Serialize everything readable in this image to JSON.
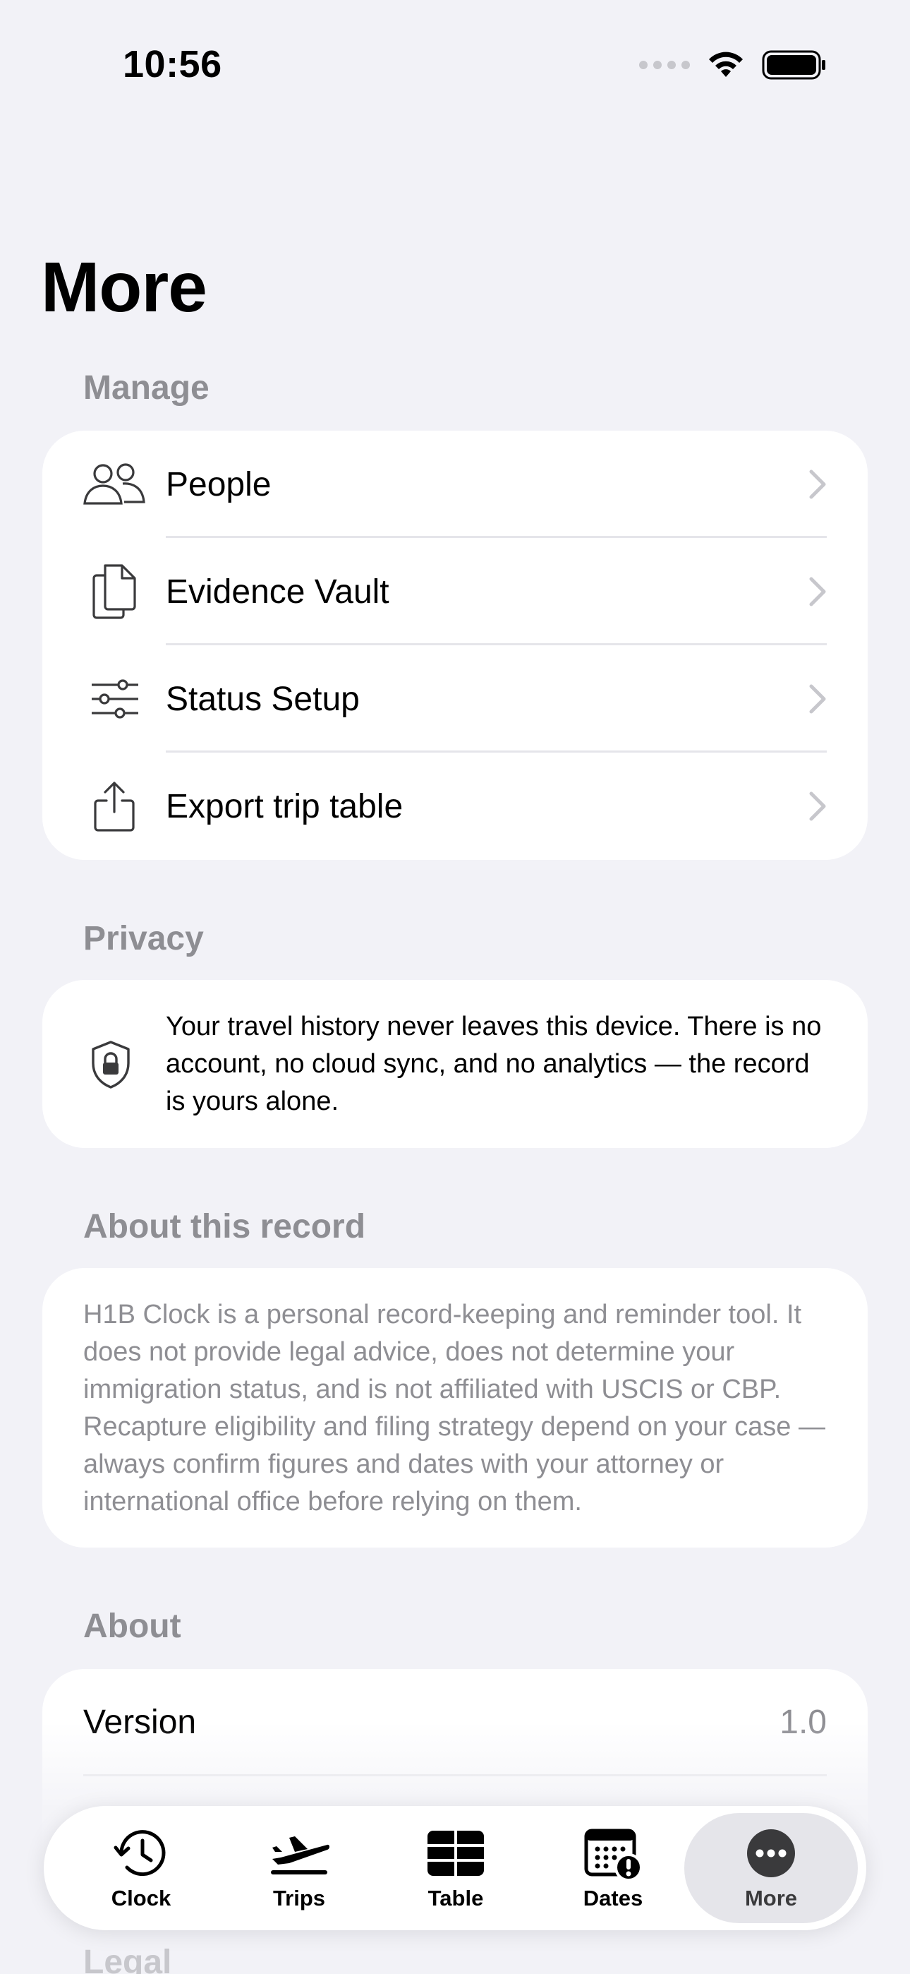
{
  "status_bar": {
    "time": "10:56"
  },
  "title": "More",
  "sections": {
    "manage": {
      "header": "Manage",
      "items": [
        {
          "label": "People",
          "icon": "people-icon"
        },
        {
          "label": "Evidence Vault",
          "icon": "documents-icon"
        },
        {
          "label": "Status Setup",
          "icon": "sliders-icon"
        },
        {
          "label": "Export trip table",
          "icon": "share-icon"
        }
      ]
    },
    "privacy": {
      "header": "Privacy",
      "text": "Your travel history never leaves this device. There is no account, no cloud sync, and no analytics — the record is yours alone.",
      "icon": "lock-shield-icon"
    },
    "about_record": {
      "header": "About this record",
      "text": "H1B Clock is a personal record-keeping and reminder tool. It does not provide legal advice, does not determine your immigration status, and is not affiliated with USCIS or CBP. Recapture eligibility and filing strategy depend on your case — always confirm figures and dates with your attorney or international office before relying on them."
    },
    "about": {
      "header": "About",
      "version_label": "Version",
      "version_value": "1.0"
    },
    "legal": {
      "header": "Legal"
    }
  },
  "tabbar": {
    "tabs": [
      {
        "label": "Clock",
        "icon": "clock-history-icon"
      },
      {
        "label": "Trips",
        "icon": "airplane-departure-icon"
      },
      {
        "label": "Table",
        "icon": "table-icon"
      },
      {
        "label": "Dates",
        "icon": "calendar-alert-icon"
      },
      {
        "label": "More",
        "icon": "ellipsis-circle-icon"
      }
    ],
    "active": "More"
  },
  "colors": {
    "background": "#f2f2f7",
    "card": "#ffffff",
    "secondary_text": "#8e8e93",
    "separator": "#e5e5ea",
    "icon": "#3a3a3c"
  }
}
